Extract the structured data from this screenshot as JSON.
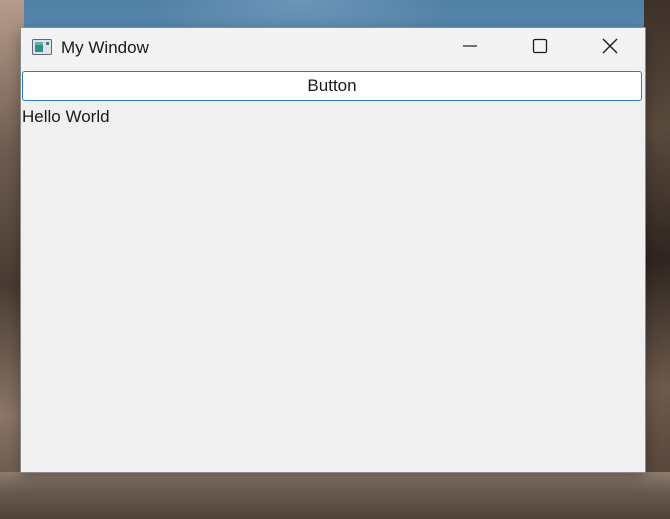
{
  "window": {
    "title": "My Window",
    "icon": "app-window-icon"
  },
  "caption_buttons": {
    "minimize_icon": "minimize-icon",
    "maximize_icon": "maximize-icon",
    "close_icon": "close-icon"
  },
  "content": {
    "button_label": "Button",
    "label_text": "Hello World"
  },
  "colors": {
    "window_bg": "#f0f0f0",
    "button_border": "#2e7ac4",
    "text": "#1a1a1a"
  }
}
